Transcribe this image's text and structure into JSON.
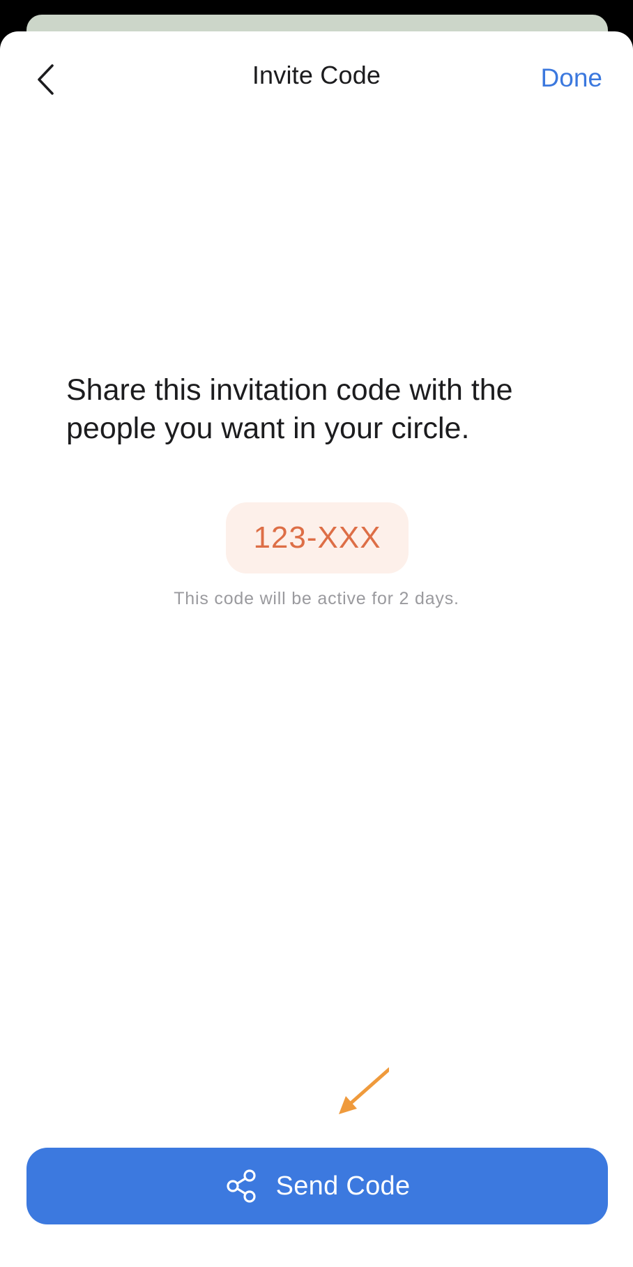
{
  "header": {
    "title": "Invite Code",
    "done_label": "Done",
    "back_icon": "chevron-left-icon"
  },
  "main": {
    "message": "Share this invitation code with the people you want in your circle.",
    "code": "123-XXX",
    "note": "This code will be active for 2 days."
  },
  "footer": {
    "send_label": "Send Code",
    "send_icon": "share-icon"
  },
  "colors": {
    "accent": "#3c79df",
    "code_text": "#dd6e46",
    "code_bg": "#fdf0ea",
    "annotation_arrow": "#ef9a3c"
  }
}
